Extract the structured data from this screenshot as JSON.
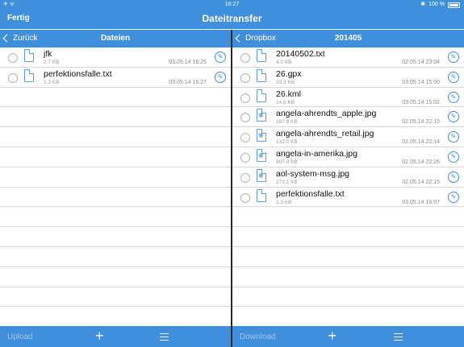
{
  "status": {
    "left": "✈ ᯤ",
    "time": "16:27",
    "bluetooth": "✱",
    "battery": "100 %"
  },
  "nav": {
    "title": "Dateitransfer",
    "done": "Fertig"
  },
  "left": {
    "back": "Zurück",
    "title": "Dateien",
    "files": [
      {
        "name": "jfk",
        "size": "2.7 KB",
        "date": "03.05.14 16:25",
        "type": "doc"
      },
      {
        "name": "perfektionsfalle.txt",
        "size": "1.3 KB",
        "date": "03.05.14 16:27",
        "type": "doc"
      }
    ],
    "empty_rows": 12,
    "action": "Upload"
  },
  "right": {
    "back": "Dropbox",
    "title": "201405",
    "files": [
      {
        "name": "20140502.txt",
        "size": "4.0 KB",
        "date": "02.05.14 23:04",
        "type": "doc"
      },
      {
        "name": "26.gpx",
        "size": "53.3 KB",
        "date": "03.05.14 15:00",
        "type": "doc"
      },
      {
        "name": "26.kml",
        "size": "14.6 KB",
        "date": "03.05.14 15:02",
        "type": "doc"
      },
      {
        "name": "angela-ahrendts_apple.jpg",
        "size": "187.9 KB",
        "date": "02.05.14 22:15",
        "type": "img"
      },
      {
        "name": "angela-ahrendts_retail.jpg",
        "size": "131.0 KB",
        "date": "02.05.14 22:14",
        "type": "img"
      },
      {
        "name": "angela-in-amerika.jpg",
        "size": "607.4 KB",
        "date": "02.05.14 22:26",
        "type": "img"
      },
      {
        "name": "aol-system-msg.jpg",
        "size": "273.2 KB",
        "date": "02.05.14 22:15",
        "type": "img"
      },
      {
        "name": "perfektionsfalle.txt",
        "size": "1.3 KB",
        "date": "03.05.14 16:07",
        "type": "doc"
      }
    ],
    "empty_rows": 6,
    "action": "Download"
  },
  "toolbar": {
    "plus": "+"
  },
  "colors": {
    "accent": "#3f8fdd"
  }
}
